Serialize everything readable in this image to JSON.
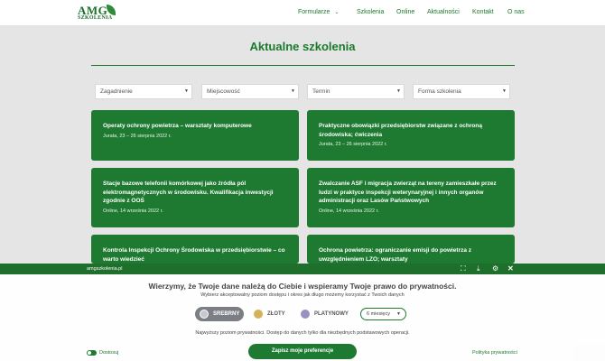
{
  "header": {
    "logo_text": "AMG",
    "logo_subtext": "SZKOLENIA",
    "nav": [
      {
        "label": "Formularze",
        "has_dropdown": true
      },
      {
        "label": "Szkolenia"
      },
      {
        "label": "Online"
      },
      {
        "label": "Aktualności"
      },
      {
        "label": "Kontakt"
      },
      {
        "label": "O nas"
      }
    ]
  },
  "page": {
    "title": "Aktualne szkolenia"
  },
  "filters": [
    {
      "label": "Zagadnienie"
    },
    {
      "label": "Miejscowość"
    },
    {
      "label": "Termin"
    },
    {
      "label": "Forma szkolenia"
    }
  ],
  "cards": [
    {
      "title": "Operaty ochrony powietrza – warsztaty komputerowe",
      "meta": "Jurata, 23 – 26 sierpnia 2022 r."
    },
    {
      "title": "Praktyczne obowiązki przedsiębiorstw związane z ochroną środowiska; ćwiczenia",
      "meta": "Jurata, 23 – 26 sierpnia 2022 r."
    },
    {
      "title": "Stacje bazowe telefonii komórkowej jako źródła pól elektromagnetycznych w środowisku. Kwalifikacja inwestycji zgodnie z OOŚ",
      "meta": "Online, 14 września 2022 r."
    },
    {
      "title": "Zwalczanie ASF i migracja zwierząt na tereny zamieszkałe przez ludzi w praktyce inspekcji weterynaryjnej i innych organów administracji oraz Lasów Państwowych",
      "meta": "Online, 14 września 2022 r."
    },
    {
      "title": "Kontrola Inspekcji Ochrony Środowiska w przedsiębiorstwie – co warto wiedzieć",
      "meta": ""
    },
    {
      "title": "Ochrona powietrza: ograniczanie emisji do powietrza z uwzględnieniem LZO; warsztaty",
      "meta": ""
    }
  ],
  "consent": {
    "url": "amgszkolenia.pl",
    "title": "Wierzymy, że Twoje dane należą do Ciebie i wspieramy Twoje prawo do prywatności.",
    "subtitle": "Wybierz akceptowalny poziom dostępu i okres jak długo możemy korzystać z Twoich danych",
    "levels": [
      {
        "label": "SREBRNY",
        "selected": true,
        "color": "#c7c9cc"
      },
      {
        "label": "ZŁOTY",
        "color": "#d4b15a"
      },
      {
        "label": "PLATYNOWY",
        "color": "#9a8fc2"
      }
    ],
    "duration": "6 miesięcy",
    "note": "Najwyższy poziom prywatności. Dostęp do danych tylko dla niezbędnych podstawowych operacji.",
    "save_label": "Zapisz moje preferencje",
    "customize_label": "Dostosuj",
    "privacy_label": "Polityka prywatności"
  },
  "colors": {
    "brand_green": "#1e7a31",
    "page_background": "#e5e5e5"
  }
}
